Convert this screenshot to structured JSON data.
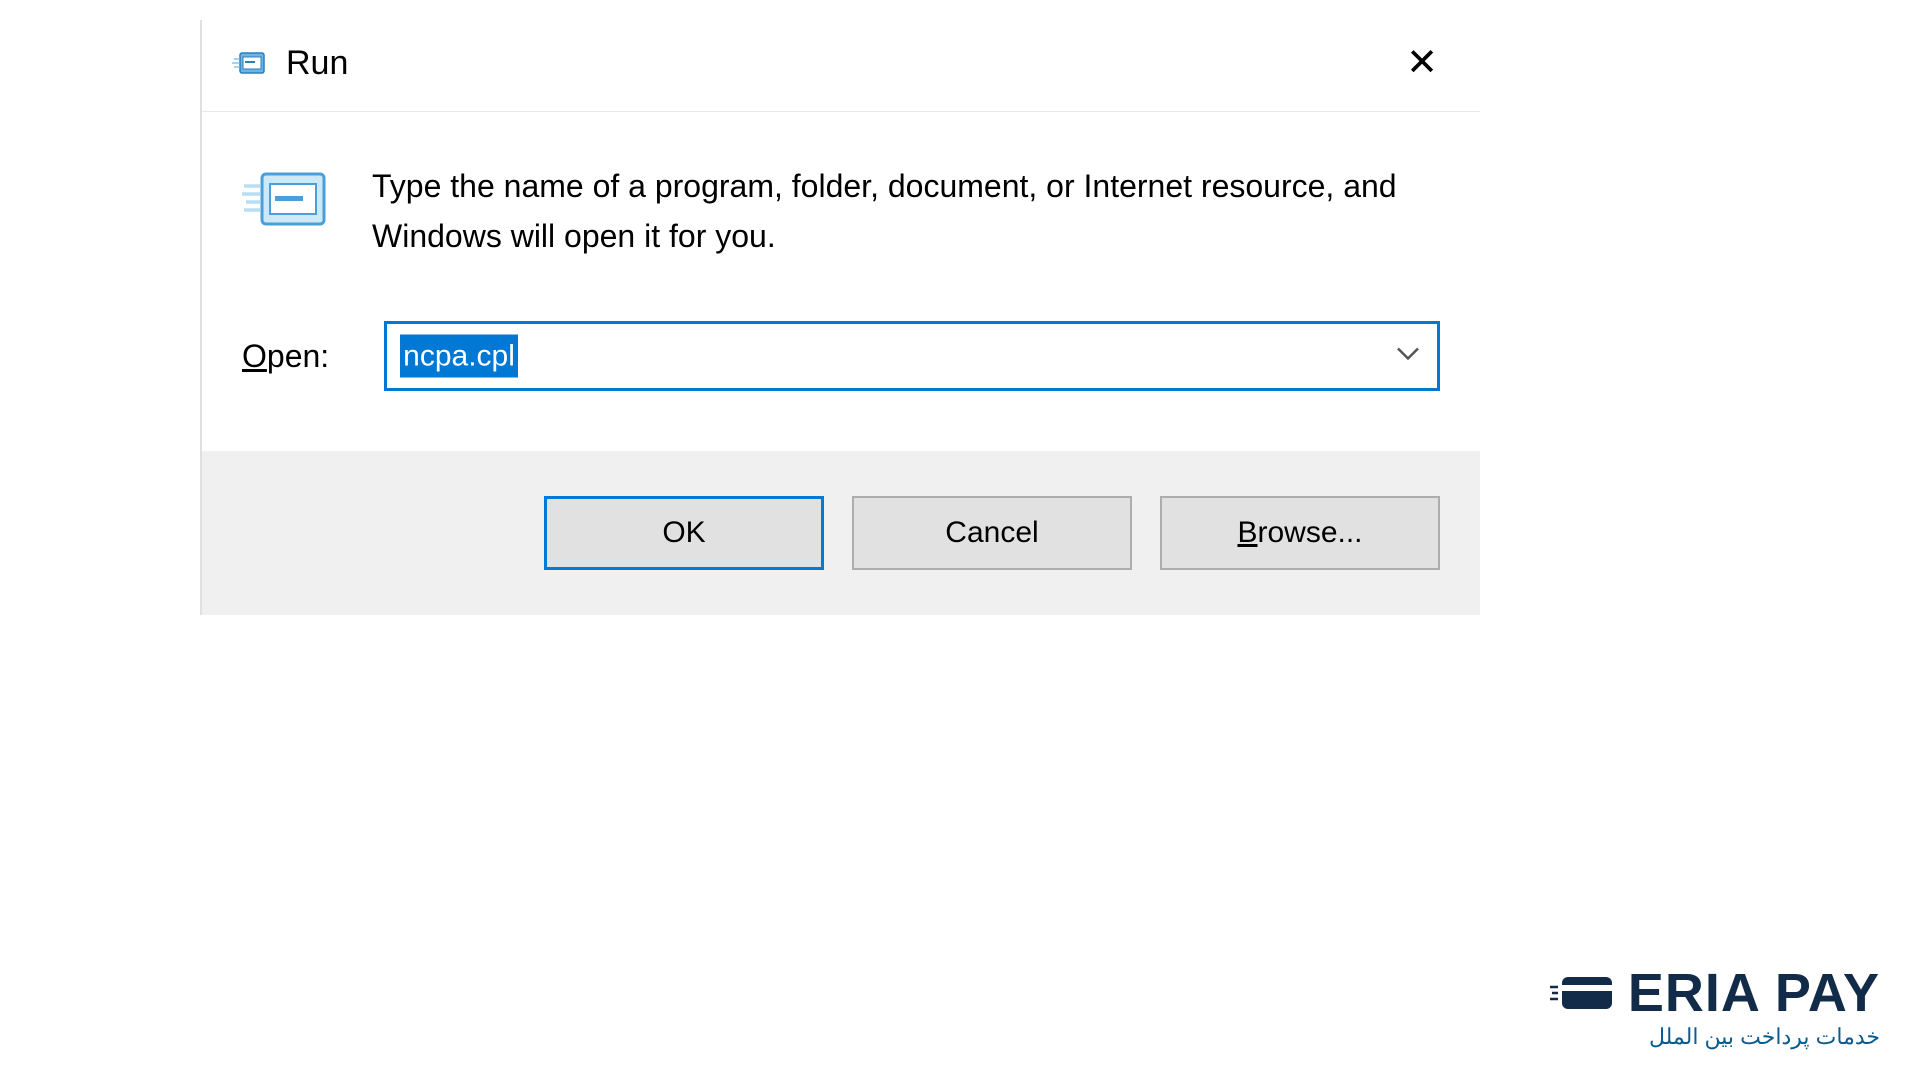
{
  "dialog": {
    "title": "Run",
    "description": "Type the name of a program, folder, document, or Internet resource, and Windows will open it for you.",
    "open_label_prefix": "O",
    "open_label_rest": "pen:",
    "input_value": "ncpa.cpl",
    "buttons": {
      "ok": "OK",
      "cancel": "Cancel",
      "browse_prefix": "B",
      "browse_rest": "rowse..."
    }
  },
  "watermark": {
    "brand": "ERIA PAY",
    "subtitle": "خدمات پرداخت بین الملل"
  }
}
